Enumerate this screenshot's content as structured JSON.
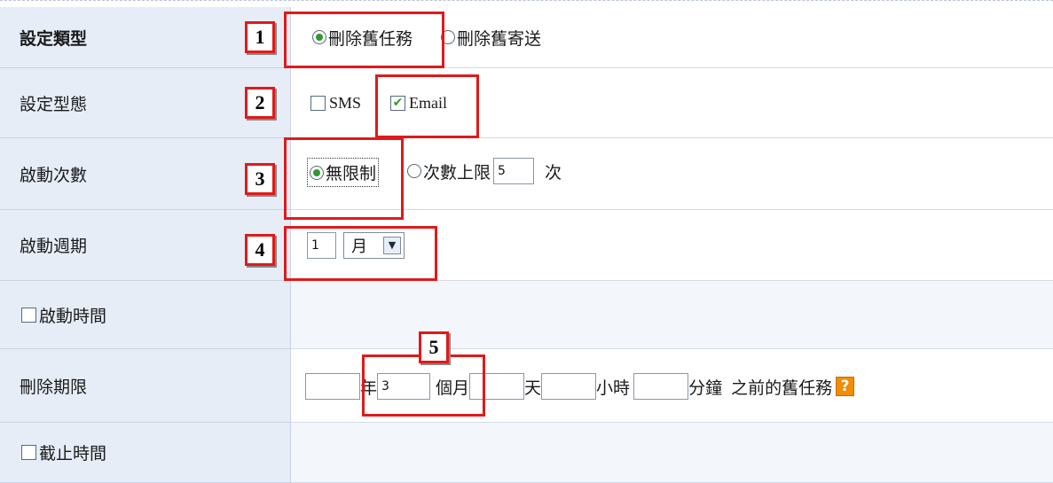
{
  "rows": {
    "type": {
      "label": "設定類型",
      "options": [
        "刪除舊任務",
        "刪除舊寄送"
      ],
      "selected": "刪除舊任務"
    },
    "mode": {
      "label": "設定型態",
      "sms": "SMS",
      "email": "Email",
      "sms_checked": false,
      "email_checked": true
    },
    "count": {
      "label": "啟動次數",
      "opt_unlimited": "無限制",
      "opt_limit": "次數上限",
      "limit_value": "5",
      "unit": "次"
    },
    "period": {
      "label": "啟動週期",
      "value": "1",
      "unit_selected": "月"
    },
    "start_time": {
      "label": "啟動時間"
    },
    "delete_limit": {
      "label": "刪除期限",
      "year_value": "",
      "year_unit": "年",
      "month_value": "3",
      "month_unit": "個月",
      "day_value": "",
      "day_unit": "天",
      "hour_value": "",
      "hour_unit": "小時",
      "minute_value": "",
      "minute_unit": "分鐘",
      "suffix": "之前的舊任務",
      "help": "?"
    },
    "end_time": {
      "label": "截止時間"
    }
  },
  "markers": [
    "1",
    "2",
    "3",
    "4",
    "5"
  ],
  "colors": {
    "highlight": "#e01a1a",
    "label_bg": "#e6edf7",
    "check_green": "#2f9a2f",
    "help_orange": "#f28c00"
  }
}
